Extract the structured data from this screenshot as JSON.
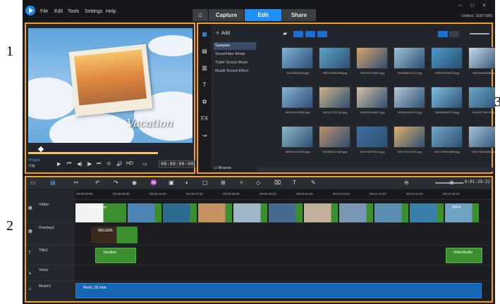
{
  "callouts": [
    "1",
    "2",
    "3"
  ],
  "menu": [
    "File",
    "Edit",
    "Tools",
    "Settings",
    "Help"
  ],
  "tabs": [
    {
      "label": "Capture"
    },
    {
      "label": "Edit"
    },
    {
      "label": "Share"
    }
  ],
  "window": {
    "controls": "– □ ×",
    "resolution": "Untitled, 1920*1080"
  },
  "player": {
    "overlay_text": "Vacation",
    "project_label": "Project",
    "clip_label": "Clip",
    "hd_label": "HD",
    "timecode": "00:00:00:00",
    "controls": [
      "⏮",
      "◀|",
      "|▶",
      "⏭",
      "⟲",
      "🔊"
    ]
  },
  "library": {
    "add_label": "Add",
    "categories": [
      "Samples",
      "ScoreFitter Music",
      "Triple Scoop Music",
      "Musik Sound Effect"
    ],
    "browse_label": "Browse",
    "tool_labels": [
      "FX",
      "T"
    ],
    "media_files": [
      "IMG45485482.jpg",
      "IMG497881598.jpg",
      "IMG535785633.jpg",
      "IMG586629710.jpg",
      "IMG592854222.jpg",
      "IMG604862086.jpg",
      "IMG610297889.jpg",
      "IMG671574140.jpg",
      "IMG632440807.jpg",
      "IMG651321610.jpg",
      "IMG653660705.jpg",
      "IMG657138718.jpg",
      "IMG674670150.jpg",
      "IMG683267359.jpg",
      "IMG702909121.jpg",
      "IMG703175781.jpg",
      "IMG7395698389.jpg",
      "IMG763402642.jpg"
    ]
  },
  "timeline": {
    "duration": "0:01:29:22",
    "ruler": [
      "00:00:00:00",
      "00:00:09:00",
      "00:00:18:00",
      "00:00:27:00",
      "00:00:36:00",
      "00:00:45:00",
      "00:00:54:00",
      "00:01:03:02",
      "00:01:12:02",
      "00:01:21:02",
      "00:01:30:02"
    ],
    "tracks": [
      "Video",
      "Overlay1",
      "Title1",
      "Voice",
      "Music1"
    ],
    "clips": {
      "video_first": "Travel 01_Start",
      "video_last": "IMG4",
      "overlay": "IMG1836",
      "title_a": "Vacation",
      "title_b": "VideoStudio",
      "music": "Music_02.mpa"
    }
  }
}
